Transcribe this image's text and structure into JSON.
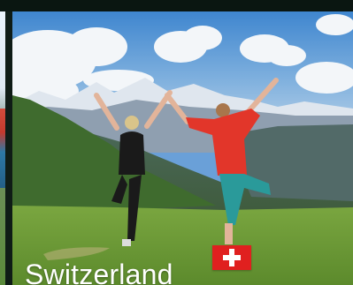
{
  "card": {
    "title": "Switzerland",
    "flag_icon": "swiss-flag-icon",
    "image_alt": "mountain-yoga-photo"
  },
  "colors": {
    "background": "#0f1c16",
    "flag_red": "#e0201f",
    "caption_text": "#ffffff"
  }
}
